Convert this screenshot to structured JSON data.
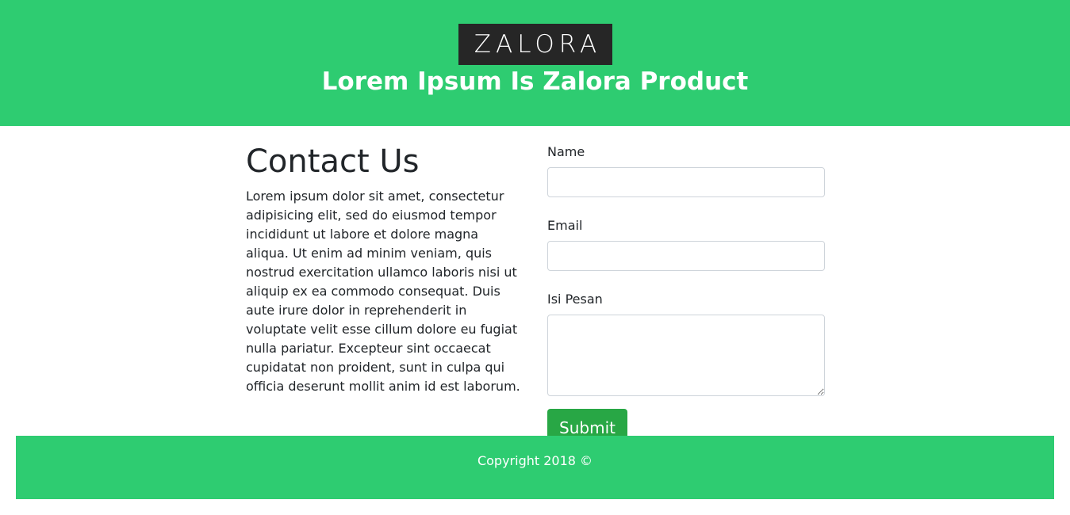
{
  "header": {
    "logo_text": "ZALORA",
    "tagline": "Lorem Ipsum Is Zalora Product"
  },
  "contact": {
    "title": "Contact Us",
    "body": "Lorem ipsum dolor sit amet, consectetur adipisicing elit, sed do eiusmod tempor incididunt ut labore et dolore magna aliqua. Ut enim ad minim veniam, quis nostrud exercitation ullamco laboris nisi ut aliquip ex ea commodo consequat. Duis aute irure dolor in reprehenderit in voluptate velit esse cillum dolore eu fugiat nulla pariatur. Excepteur sint occaecat cupidatat non proident, sunt in culpa qui officia deserunt mollit anim id est laborum."
  },
  "form": {
    "name_label": "Name",
    "name_value": "",
    "email_label": "Email",
    "email_value": "",
    "message_label": "Isi Pesan",
    "message_value": "",
    "submit_label": "Submit"
  },
  "footer": {
    "copyright": "Copyright 2018 ©"
  },
  "colors": {
    "brand_green": "#2ecc71",
    "button_green": "#28a745",
    "logo_bg": "#262626"
  }
}
